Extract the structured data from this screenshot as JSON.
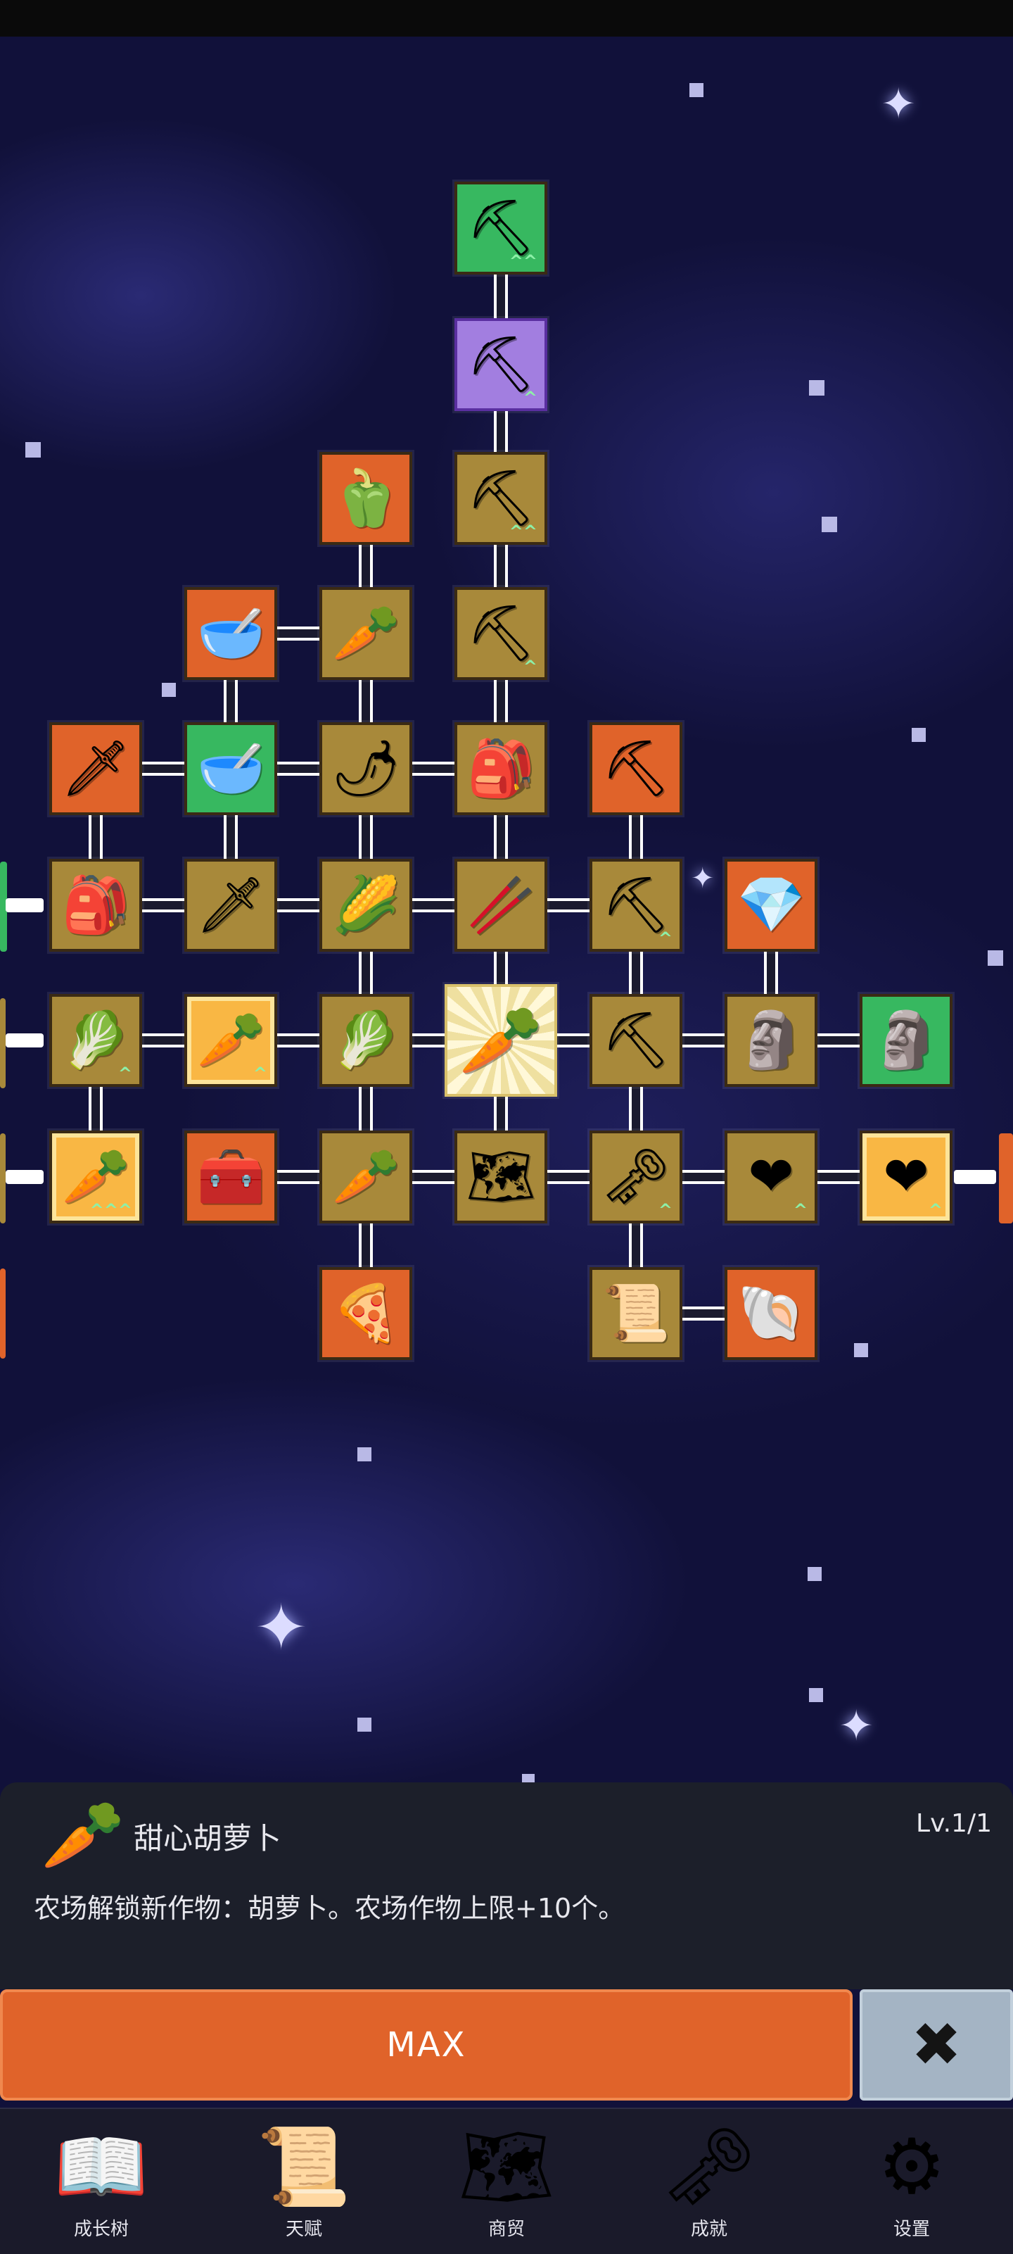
{
  "colors": {
    "background": "#11113a",
    "node_tan": "#a8893a",
    "node_orange": "#e0632a",
    "node_green": "#37b860",
    "node_purple": "#a27ee0",
    "max_button": "#e0632a",
    "close_button": "#a4b4c4"
  },
  "tree": {
    "nodes": [
      {
        "id": "shovel-top",
        "icon": "shovel-icon",
        "glyph": "⛏",
        "style": "green",
        "upgrade": "^^"
      },
      {
        "id": "shovel-magic",
        "icon": "magic-shovel-icon",
        "glyph": "⛏",
        "style": "purple",
        "upgrade": "^"
      },
      {
        "id": "pepper",
        "icon": "bell-pepper-icon",
        "glyph": "🫑",
        "style": "orange",
        "upgrade": ""
      },
      {
        "id": "shovel-3",
        "icon": "shovel-icon",
        "glyph": "⛏",
        "style": "tan",
        "upgrade": "^^"
      },
      {
        "id": "bowl-grain",
        "icon": "grain-bowl-icon",
        "glyph": "🥣",
        "style": "orange",
        "upgrade": ""
      },
      {
        "id": "radish",
        "icon": "radish-icon",
        "glyph": "🥕",
        "style": "tan",
        "upgrade": ""
      },
      {
        "id": "shovel-4",
        "icon": "shovel-icon",
        "glyph": "⛏",
        "style": "tan",
        "upgrade": "^"
      },
      {
        "id": "golden-sword",
        "icon": "golden-sword-icon",
        "glyph": "🗡",
        "style": "orange",
        "upgrade": ""
      },
      {
        "id": "bowl-empty",
        "icon": "bowl-icon",
        "glyph": "🥣",
        "style": "green",
        "upgrade": ""
      },
      {
        "id": "chili",
        "icon": "chili-pepper-icon",
        "glyph": "🌶",
        "style": "tan",
        "upgrade": ""
      },
      {
        "id": "backpack-big",
        "icon": "backpack-icon",
        "glyph": "🎒",
        "style": "tan",
        "upgrade": ""
      },
      {
        "id": "pickaxe-gold",
        "icon": "pickaxe-icon",
        "glyph": "⛏",
        "style": "orange",
        "upgrade": ""
      },
      {
        "id": "backpack",
        "icon": "backpack-icon",
        "glyph": "🎒",
        "style": "tan",
        "upgrade": ""
      },
      {
        "id": "sword",
        "icon": "sword-icon",
        "glyph": "🗡",
        "style": "tan",
        "upgrade": ""
      },
      {
        "id": "corn",
        "icon": "corn-icon",
        "glyph": "🌽",
        "style": "tan",
        "upgrade": ""
      },
      {
        "id": "stick",
        "icon": "stick-icon",
        "glyph": "🥢",
        "style": "tan",
        "upgrade": ""
      },
      {
        "id": "pickaxe-1",
        "icon": "pickaxe-icon",
        "glyph": "⛏",
        "style": "tan",
        "upgrade": "^"
      },
      {
        "id": "crystal",
        "icon": "crystal-icon",
        "glyph": "💎",
        "style": "orange",
        "upgrade": ""
      },
      {
        "id": "cabbage-1",
        "icon": "cabbage-icon",
        "glyph": "🥬",
        "style": "tan",
        "upgrade": "^"
      },
      {
        "id": "carrot-boost",
        "icon": "carrot-icon",
        "glyph": "🥕",
        "style": "gold-orange",
        "upgrade": "^"
      },
      {
        "id": "cabbage-2",
        "icon": "cabbage-icon",
        "glyph": "🥬",
        "style": "tan",
        "upgrade": ""
      },
      {
        "id": "carrot-selected",
        "icon": "carrot-icon",
        "glyph": "🥕",
        "style": "selected",
        "upgrade": ""
      },
      {
        "id": "pickaxe-2",
        "icon": "pickaxe-icon",
        "glyph": "⛏",
        "style": "tan",
        "upgrade": ""
      },
      {
        "id": "statue-1",
        "icon": "statue-icon",
        "glyph": "🗿",
        "style": "tan",
        "upgrade": ""
      },
      {
        "id": "statue-2",
        "icon": "statue-icon",
        "glyph": "🗿",
        "style": "green",
        "upgrade": ""
      },
      {
        "id": "carrot-upgrade",
        "icon": "carrot-icon",
        "glyph": "🥕",
        "style": "gold-orange",
        "upgrade": "^^^"
      },
      {
        "id": "chest",
        "icon": "treasure-chest-icon",
        "glyph": "🧰",
        "style": "orange",
        "upgrade": ""
      },
      {
        "id": "parsnip",
        "icon": "parsnip-icon",
        "glyph": "🥕",
        "style": "tan",
        "upgrade": ""
      },
      {
        "id": "map",
        "icon": "map-icon",
        "glyph": "🗺",
        "style": "tan",
        "upgrade": ""
      },
      {
        "id": "key",
        "icon": "key-icon",
        "glyph": "🗝",
        "style": "tan",
        "upgrade": "^"
      },
      {
        "id": "heart-1",
        "icon": "heart-icon",
        "glyph": "❤",
        "style": "tan",
        "upgrade": "^"
      },
      {
        "id": "heart-2",
        "icon": "heart-icon",
        "glyph": "❤",
        "style": "gold-orange",
        "upgrade": "^"
      },
      {
        "id": "pizza",
        "icon": "pizza-slice-icon",
        "glyph": "🍕",
        "style": "orange",
        "upgrade": ""
      },
      {
        "id": "scroll",
        "icon": "scroll-icon",
        "glyph": "📜",
        "style": "tan",
        "upgrade": ""
      },
      {
        "id": "fossil",
        "icon": "fossil-icon",
        "glyph": "🐚",
        "style": "orange",
        "upgrade": ""
      }
    ]
  },
  "detail": {
    "icon": "carrot-icon",
    "glyph": "🥕",
    "title": "甜心胡萝卜",
    "level": "Lv.1/1",
    "description": "农场解锁新作物：胡萝卜。农场作物上限+10个。"
  },
  "actions": {
    "max_label": "MAX",
    "close_glyph": "✖"
  },
  "nav": [
    {
      "label": "成长树",
      "icon": "book-icon",
      "glyph": "📖"
    },
    {
      "label": "天赋",
      "icon": "scroll-icon",
      "glyph": "📜"
    },
    {
      "label": "商贸",
      "icon": "map-icon",
      "glyph": "🗺"
    },
    {
      "label": "成就",
      "icon": "key-icon",
      "glyph": "🗝"
    },
    {
      "label": "设置",
      "icon": "gear-icon",
      "glyph": "⚙"
    }
  ]
}
